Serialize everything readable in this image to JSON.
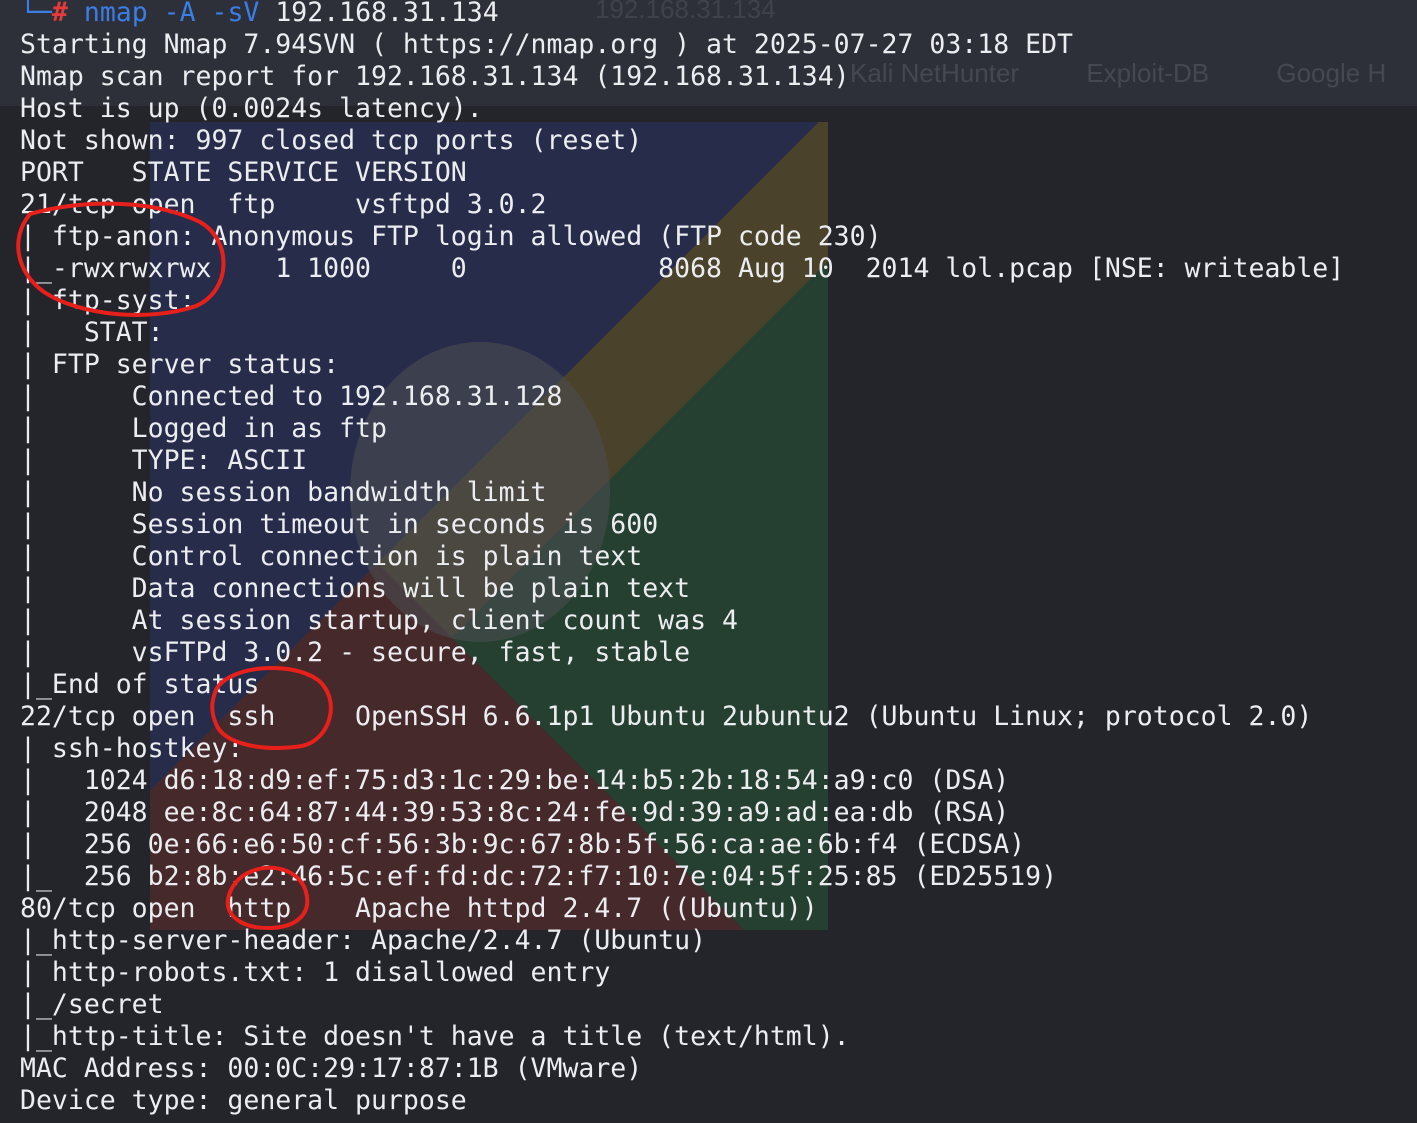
{
  "background_bookmarks": [
    "Kali NetHunter",
    "Exploit-DB",
    "Google H"
  ],
  "background_url": "192.168.31.134",
  "prompt": {
    "corner": "└─",
    "hash": "#",
    "command": "nmap -A -sV",
    "target": "192.168.31.134"
  },
  "lines": [
    "Starting Nmap 7.94SVN ( https://nmap.org ) at 2025-07-27 03:18 EDT",
    "Nmap scan report for 192.168.31.134 (192.168.31.134)",
    "Host is up (0.0024s latency).",
    "Not shown: 997 closed tcp ports (reset)",
    "PORT   STATE SERVICE VERSION",
    "21/tcp open  ftp     vsftpd 3.0.2",
    "| ftp-anon: Anonymous FTP login allowed (FTP code 230)",
    "|_-rwxrwxrwx    1 1000     0            8068 Aug 10  2014 lol.pcap [NSE: writeable]",
    "| ftp-syst: ",
    "|   STAT: ",
    "| FTP server status:",
    "|      Connected to 192.168.31.128",
    "|      Logged in as ftp",
    "|      TYPE: ASCII",
    "|      No session bandwidth limit",
    "|      Session timeout in seconds is 600",
    "|      Control connection is plain text",
    "|      Data connections will be plain text",
    "|      At session startup, client count was 4",
    "|      vsFTPd 3.0.2 - secure, fast, stable",
    "|_End of status",
    "22/tcp open  ssh     OpenSSH 6.6.1p1 Ubuntu 2ubuntu2 (Ubuntu Linux; protocol 2.0)",
    "| ssh-hostkey: ",
    "|   1024 d6:18:d9:ef:75:d3:1c:29:be:14:b5:2b:18:54:a9:c0 (DSA)",
    "|   2048 ee:8c:64:87:44:39:53:8c:24:fe:9d:39:a9:ad:ea:db (RSA)",
    "|   256 0e:66:e6:50:cf:56:3b:9c:67:8b:5f:56:ca:ae:6b:f4 (ECDSA)",
    "|_  256 b2:8b:e2:46:5c:ef:fd:dc:72:f7:10:7e:04:5f:25:85 (ED25519)",
    "80/tcp open  http    Apache httpd 2.4.7 ((Ubuntu))",
    "|_http-server-header: Apache/2.4.7 (Ubuntu)",
    "| http-robots.txt: 1 disallowed entry ",
    "|_/secret",
    "|_http-title: Site doesn't have a title (text/html).",
    "MAC Address: 00:0C:29:17:87:1B (VMware)",
    "Device type: general purpose"
  ],
  "annotation_color": "#e8201c"
}
